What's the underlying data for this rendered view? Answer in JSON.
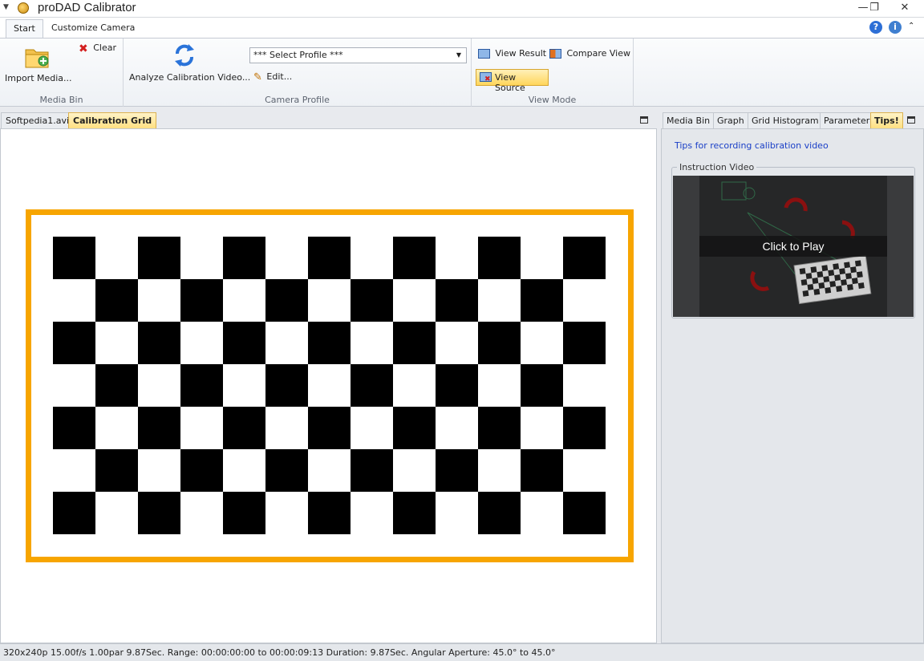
{
  "window": {
    "title": "proDAD Calibrator",
    "controls": {
      "minimize": "—",
      "maximize": "❐",
      "close": "✕"
    }
  },
  "ribbon_tabs": [
    "Start",
    "Customize Camera"
  ],
  "ribbon": {
    "media_bin": {
      "label": "Media Bin",
      "import": "Import Media...",
      "clear": "Clear"
    },
    "camera_profile": {
      "label": "Camera Profile",
      "analyze": "Analyze Calibration Video...",
      "select_profile": "*** Select Profile ***",
      "edit": "Edit..."
    },
    "view_mode": {
      "label": "View Mode",
      "view_result": "View Result",
      "compare_view": "Compare View",
      "view_source": "View Source"
    }
  },
  "document_tabs": [
    "Softpedia1.avi",
    "Calibration Grid"
  ],
  "right_tabs": [
    "Media Bin",
    "Graph",
    "Grid Histogram",
    "Parameter",
    "Tips!"
  ],
  "tips": {
    "link": "Tips for recording calibration video",
    "instruction_label": "Instruction Video",
    "play": "Click to Play"
  },
  "calibration_grid": {
    "rows": 7,
    "cols": 13,
    "frame_color": "#f7a500"
  },
  "status": "320x240p   15.00f/s   1.00par   9.87Sec.   Range: 00:00:00:00 to 00:00:09:13   Duration: 9.87Sec.   Angular Aperture: 45.0° to 45.0°"
}
